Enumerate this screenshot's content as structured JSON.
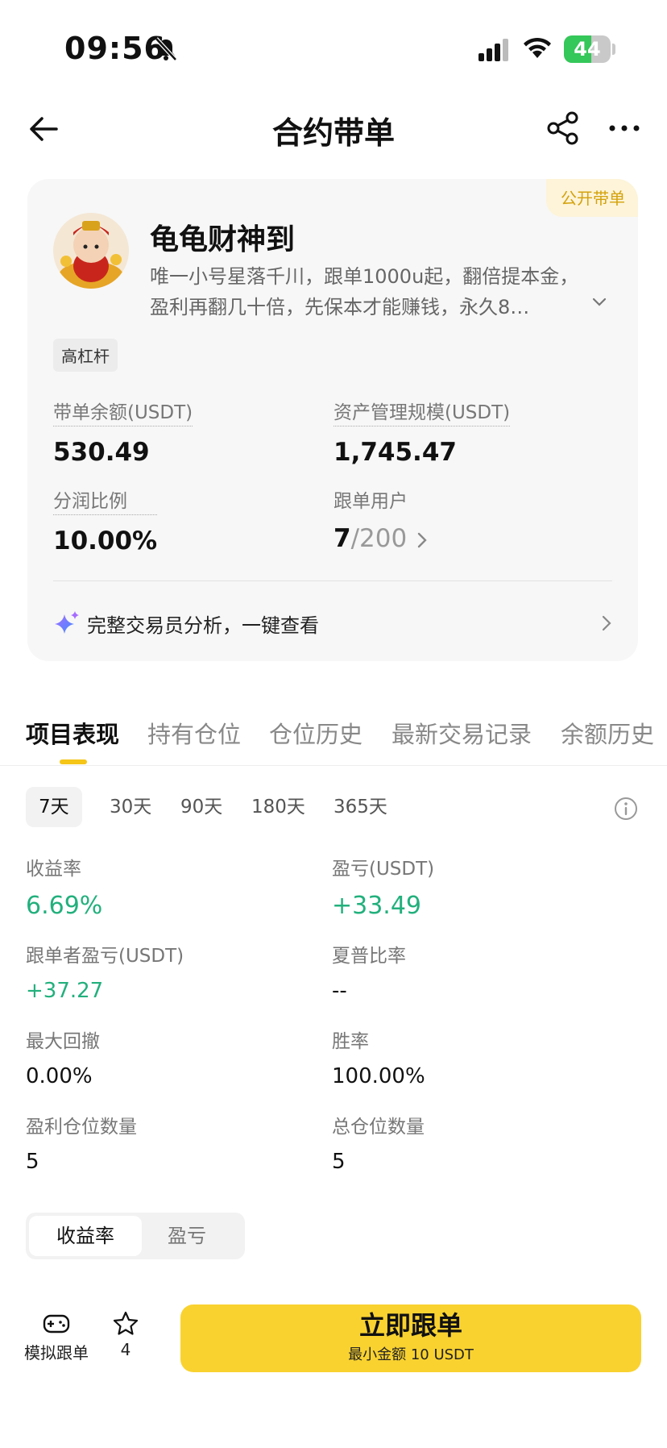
{
  "status_bar": {
    "time": "09:56",
    "battery": "44"
  },
  "nav": {
    "title": "合约带单"
  },
  "trader": {
    "badge": "公开带单",
    "name": "龟龟财神到",
    "description": "唯一小号星落千川，跟单1000u起，翻倍提本金，盈利再翻几十倍，先保本才能赚钱，永久8…",
    "tag": "高杠杆",
    "stats": {
      "balance_label": "带单余额(USDT)",
      "balance_value": "530.49",
      "aum_label": "资产管理规模(USDT)",
      "aum_value": "1,745.47",
      "share_label": "分润比例",
      "share_value": "10.00%",
      "followers_label": "跟单用户",
      "followers_count": "7",
      "followers_max": "/200"
    },
    "analysis_text": "完整交易员分析，一键查看"
  },
  "tabs": [
    "项目表现",
    "持有仓位",
    "仓位历史",
    "最新交易记录",
    "余额历史"
  ],
  "periods": [
    "7天",
    "30天",
    "90天",
    "180天",
    "365天"
  ],
  "metrics": {
    "roi_label": "收益率",
    "roi_value": "6.69%",
    "pnl_label": "盈亏(USDT)",
    "pnl_value": "+33.49",
    "follower_pnl_label": "跟单者盈亏(USDT)",
    "follower_pnl_value": "+37.27",
    "sharpe_label": "夏普比率",
    "sharpe_value": "--",
    "drawdown_label": "最大回撤",
    "drawdown_value": "0.00%",
    "winrate_label": "胜率",
    "winrate_value": "100.00%",
    "win_positions_label": "盈利仓位数量",
    "win_positions_value": "5",
    "total_positions_label": "总仓位数量",
    "total_positions_value": "5"
  },
  "chart_toggle": [
    "收益率",
    "盈亏"
  ],
  "bottom": {
    "demo_label": "模拟跟单",
    "favorite_count": "4",
    "follow_label": "立即跟单",
    "follow_sub": "最小金额 10 USDT"
  },
  "colors": {
    "accent": "#f9d230",
    "positive": "#22b07d",
    "badge_text": "#d4a20c"
  }
}
